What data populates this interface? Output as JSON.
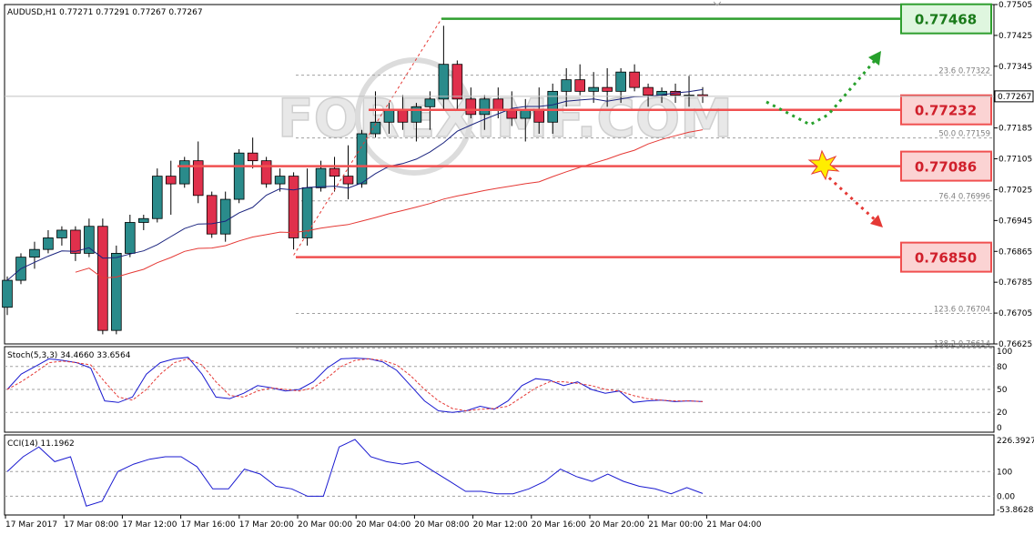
{
  "main_panel": {
    "header": "AUDUSD,H1  0.77271 0.77291 0.77267 0.77267",
    "current_price": "0.77267",
    "price_ticks": [
      "0.77505",
      "0.77425",
      "0.77345",
      "0.77265",
      "0.77185",
      "0.77105",
      "0.77025",
      "0.76945",
      "0.76865",
      "0.76785",
      "0.76705",
      "0.76625"
    ],
    "fib_labels": [
      {
        "label": "23.6 0.77322",
        "value": 0.77322
      },
      {
        "label": "50.0 0.77159",
        "value": 0.77159
      },
      {
        "label": "76.4 0.76996",
        "value": 0.76996
      },
      {
        "label": "123.6 0.76704",
        "value": 0.76704
      },
      {
        "label": "138.2 0.76614",
        "value": 0.76614
      }
    ],
    "levels": [
      {
        "label": "0.77468",
        "value": 0.77468,
        "kind": "resistance",
        "color": "#2e9e2e",
        "fill": "#dff6df"
      },
      {
        "label": "0.77232",
        "value": 0.77232,
        "kind": "pivot",
        "color": "#f05050",
        "fill": "#fbd3d3"
      },
      {
        "label": "0.77086",
        "value": 0.77086,
        "kind": "pivot",
        "color": "#f05050",
        "fill": "#fbd3d3"
      },
      {
        "label": "0.76850",
        "value": 0.7685,
        "kind": "support",
        "color": "#f05050",
        "fill": "#fbd3d3"
      }
    ],
    "watermark": "FOREXIMF.COM",
    "colors": {
      "bull": "#2a8b8b",
      "bear": "#e0304c",
      "ma_fast": "#1a237e",
      "ma_slow": "#e53935",
      "grid": "#a0a0a0"
    }
  },
  "stoch_panel": {
    "header": "Stoch(5,3,3) 34.4660 33.6564",
    "ticks": [
      "100",
      "80",
      "50",
      "20",
      "0"
    ]
  },
  "cci_panel": {
    "header": "CCI(14) 11.1962",
    "ticks": [
      "226.3927",
      "100",
      "0.00",
      "-53.8628"
    ]
  },
  "time_axis": [
    "17 Mar 2017",
    "17 Mar 08:00",
    "17 Mar 12:00",
    "17 Mar 16:00",
    "17 Mar 20:00",
    "20 Mar 00:00",
    "20 Mar 04:00",
    "20 Mar 08:00",
    "20 Mar 12:00",
    "20 Mar 16:00",
    "20 Mar 20:00",
    "21 Mar 00:00",
    "21 Mar 04:00"
  ],
  "chart_data": {
    "type": "candlestick",
    "symbol": "AUDUSD",
    "timeframe": "H1",
    "ylim": [
      0.76625,
      0.77505
    ],
    "candles": [
      [
        0.7672,
        0.768,
        0.767,
        0.7679
      ],
      [
        0.7679,
        0.7686,
        0.7678,
        0.7685
      ],
      [
        0.7685,
        0.7689,
        0.7682,
        0.7687
      ],
      [
        0.7687,
        0.7692,
        0.7686,
        0.769
      ],
      [
        0.769,
        0.7693,
        0.7688,
        0.7692
      ],
      [
        0.7692,
        0.7693,
        0.7684,
        0.7686
      ],
      [
        0.7686,
        0.7695,
        0.7685,
        0.7693
      ],
      [
        0.7693,
        0.7695,
        0.7665,
        0.7666
      ],
      [
        0.7666,
        0.7688,
        0.7665,
        0.7686
      ],
      [
        0.7686,
        0.7696,
        0.7685,
        0.7694
      ],
      [
        0.7694,
        0.7696,
        0.7692,
        0.7695
      ],
      [
        0.7695,
        0.7708,
        0.7694,
        0.7706
      ],
      [
        0.7706,
        0.771,
        0.7696,
        0.7704
      ],
      [
        0.7704,
        0.7711,
        0.7703,
        0.771
      ],
      [
        0.771,
        0.7715,
        0.7699,
        0.7701
      ],
      [
        0.7701,
        0.7702,
        0.769,
        0.7691
      ],
      [
        0.7691,
        0.7702,
        0.7689,
        0.77
      ],
      [
        0.77,
        0.7713,
        0.7699,
        0.7712
      ],
      [
        0.7712,
        0.7716,
        0.7708,
        0.771
      ],
      [
        0.771,
        0.7711,
        0.7703,
        0.7704
      ],
      [
        0.7704,
        0.7708,
        0.7702,
        0.7706
      ],
      [
        0.7706,
        0.7707,
        0.7687,
        0.769
      ],
      [
        0.769,
        0.7708,
        0.7688,
        0.7703
      ],
      [
        0.7703,
        0.771,
        0.7702,
        0.7708
      ],
      [
        0.7708,
        0.7711,
        0.7702,
        0.7706
      ],
      [
        0.7706,
        0.7714,
        0.77,
        0.7704
      ],
      [
        0.7704,
        0.7718,
        0.7703,
        0.7717
      ],
      [
        0.7717,
        0.7728,
        0.7716,
        0.772
      ],
      [
        0.772,
        0.7725,
        0.7717,
        0.7723
      ],
      [
        0.7723,
        0.7727,
        0.7718,
        0.772
      ],
      [
        0.772,
        0.7725,
        0.7715,
        0.7724
      ],
      [
        0.7724,
        0.7728,
        0.7718,
        0.7726
      ],
      [
        0.7726,
        0.7745,
        0.7723,
        0.7735
      ],
      [
        0.7735,
        0.7736,
        0.7723,
        0.7726
      ],
      [
        0.7726,
        0.7729,
        0.7721,
        0.7722
      ],
      [
        0.7722,
        0.7727,
        0.7718,
        0.7726
      ],
      [
        0.7726,
        0.7729,
        0.7721,
        0.7723
      ],
      [
        0.7723,
        0.7728,
        0.7719,
        0.7721
      ],
      [
        0.7721,
        0.7726,
        0.7715,
        0.7723
      ],
      [
        0.7723,
        0.7729,
        0.7717,
        0.772
      ],
      [
        0.772,
        0.773,
        0.7717,
        0.7728
      ],
      [
        0.7728,
        0.7734,
        0.7724,
        0.7731
      ],
      [
        0.7731,
        0.7735,
        0.7727,
        0.7728
      ],
      [
        0.7728,
        0.7733,
        0.7725,
        0.7729
      ],
      [
        0.7729,
        0.7734,
        0.7724,
        0.7728
      ],
      [
        0.7728,
        0.7734,
        0.7725,
        0.7733
      ],
      [
        0.7733,
        0.7735,
        0.7728,
        0.7729
      ],
      [
        0.7729,
        0.773,
        0.7724,
        0.7727
      ],
      [
        0.7727,
        0.7729,
        0.7725,
        0.7728
      ],
      [
        0.7728,
        0.773,
        0.7725,
        0.7727
      ],
      [
        0.7727,
        0.7732,
        0.7724,
        0.7727
      ],
      [
        0.77271,
        0.77291,
        0.7725,
        0.77267
      ]
    ]
  }
}
